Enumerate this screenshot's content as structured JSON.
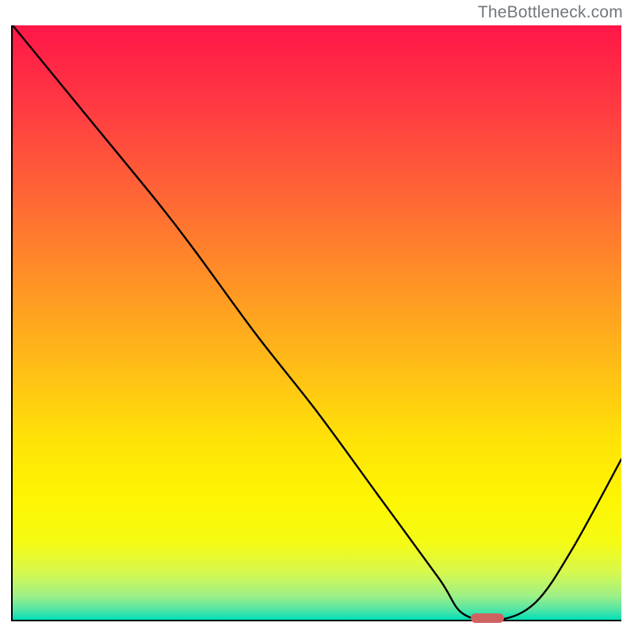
{
  "watermark": "TheBottleneck.com",
  "colors": {
    "gradient_stops": [
      {
        "offset": 0.0,
        "color": "#ff1648"
      },
      {
        "offset": 0.14,
        "color": "#ff3b42"
      },
      {
        "offset": 0.3,
        "color": "#ff6a34"
      },
      {
        "offset": 0.45,
        "color": "#ff9824"
      },
      {
        "offset": 0.58,
        "color": "#ffbf16"
      },
      {
        "offset": 0.7,
        "color": "#ffe308"
      },
      {
        "offset": 0.8,
        "color": "#fdf602"
      },
      {
        "offset": 0.87,
        "color": "#f5fb14"
      },
      {
        "offset": 0.92,
        "color": "#d7f84e"
      },
      {
        "offset": 0.96,
        "color": "#9ef087"
      },
      {
        "offset": 0.985,
        "color": "#4be5a7"
      },
      {
        "offset": 1.0,
        "color": "#00dfb6"
      }
    ],
    "frame": "#000000",
    "curve": "#000000",
    "marker": "#cf6361",
    "watermark_text": "#72777a"
  },
  "chart_data": {
    "type": "line",
    "title": "",
    "xlabel": "",
    "ylabel": "",
    "xlim": [
      0,
      100
    ],
    "ylim": [
      0,
      100
    ],
    "note": "Axes have no visible tick labels; x and y are normalized to percent of plot area width/height. y=0 at bottom (green), y=100 at top (red). The curve depicts a bottleneck/mismatch metric that is very high on the left, falls to ~0 near x≈78, then rises again toward the right edge.",
    "series": [
      {
        "name": "bottleneck-curve",
        "x": [
          0,
          12,
          24,
          30,
          40,
          50,
          60,
          70,
          74,
          80,
          86,
          92,
          100
        ],
        "y": [
          100,
          85,
          70,
          62,
          48,
          35,
          21,
          7,
          1,
          0,
          3,
          12,
          27
        ]
      }
    ],
    "marker": {
      "x": 78,
      "y": 0,
      "width_pct": 5.5
    }
  }
}
